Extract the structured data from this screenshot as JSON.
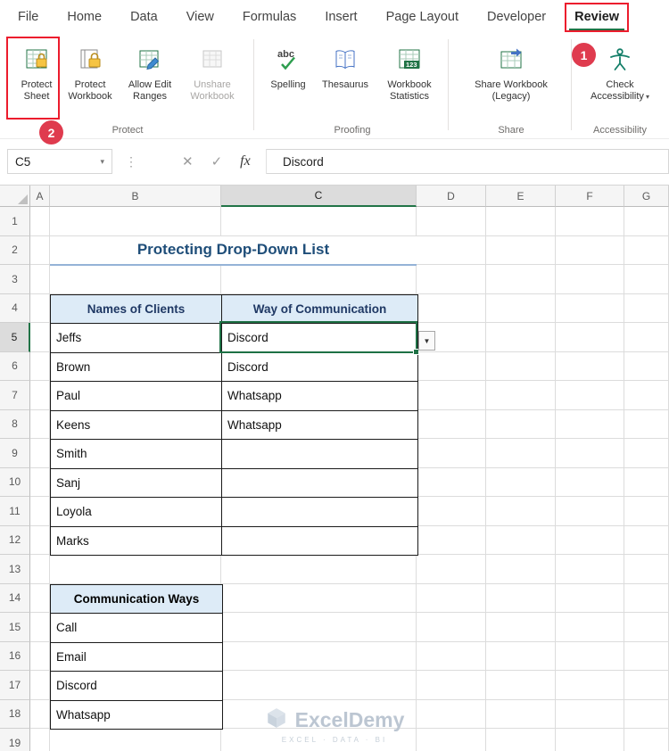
{
  "colors": {
    "excel_green": "#217346",
    "selection_green": "#1e7145",
    "annotation_red": "#ec1c2d",
    "badge_red": "#df3b4e",
    "table_header_fill": "#ddebf7",
    "title_color": "#1f4e79",
    "title_underline": "#95b3d7"
  },
  "tabs": {
    "items": [
      {
        "label": "File",
        "selected": false
      },
      {
        "label": "Home",
        "selected": false
      },
      {
        "label": "Data",
        "selected": false
      },
      {
        "label": "View",
        "selected": false
      },
      {
        "label": "Formulas",
        "selected": false
      },
      {
        "label": "Insert",
        "selected": false
      },
      {
        "label": "Page Layout",
        "selected": false
      },
      {
        "label": "Developer",
        "selected": false
      },
      {
        "label": "Review",
        "selected": true
      }
    ]
  },
  "ribbon": {
    "groups": [
      {
        "label": "Protect",
        "buttons": [
          {
            "label": "Protect Sheet",
            "disabled": false
          },
          {
            "label": "Protect Workbook",
            "disabled": false
          },
          {
            "label": "Allow Edit Ranges",
            "disabled": false
          },
          {
            "label": "Unshare Workbook",
            "disabled": true
          }
        ]
      },
      {
        "label": "Proofing",
        "buttons": [
          {
            "label": "Spelling",
            "disabled": false
          },
          {
            "label": "Thesaurus",
            "disabled": false
          },
          {
            "label": "Workbook Statistics",
            "disabled": false
          }
        ]
      },
      {
        "label": "Share",
        "buttons": [
          {
            "label": "Share Workbook (Legacy)",
            "disabled": false
          }
        ]
      },
      {
        "label": "Accessibility",
        "buttons": [
          {
            "label": "Check Accessibility",
            "disabled": false
          }
        ]
      }
    ]
  },
  "annotations": {
    "badge_1": "1",
    "badge_2": "2"
  },
  "formula_bar": {
    "name_box": "C5",
    "fx_label": "fx",
    "value": "Discord"
  },
  "sheet": {
    "column_headers": [
      "A",
      "B",
      "C",
      "D",
      "E",
      "F",
      "G"
    ],
    "row_headers": [
      "1",
      "2",
      "3",
      "4",
      "5",
      "6",
      "7",
      "8",
      "9",
      "10",
      "11",
      "12",
      "13",
      "14",
      "15",
      "16",
      "17",
      "18",
      "19"
    ],
    "selected_cell": {
      "column": "C",
      "row": "5"
    },
    "title": "Protecting Drop-Down List",
    "clients_table": {
      "headers": [
        "Names of Clients",
        "Way of Communication"
      ],
      "rows": [
        {
          "client": "Jeffs",
          "way": "Discord"
        },
        {
          "client": "Brown",
          "way": "Discord"
        },
        {
          "client": "Paul",
          "way": "Whatsapp"
        },
        {
          "client": "Keens",
          "way": "Whatsapp"
        },
        {
          "client": "Smith",
          "way": ""
        },
        {
          "client": "Sanj",
          "way": ""
        },
        {
          "client": "Loyola",
          "way": ""
        },
        {
          "client": "Marks",
          "way": ""
        }
      ]
    },
    "ways_table": {
      "header": "Communication Ways",
      "rows": [
        "Call",
        "Email",
        "Discord",
        "Whatsapp"
      ]
    },
    "watermark": {
      "name": "ExcelDemy",
      "tagline": "EXCEL · DATA · BI"
    }
  }
}
